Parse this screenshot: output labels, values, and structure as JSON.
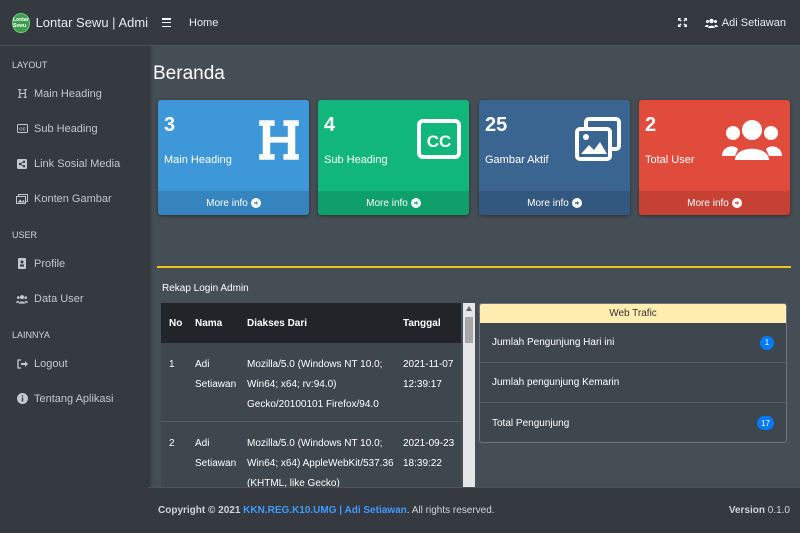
{
  "brand": {
    "logo_text": "Lontar Sewu",
    "title": "Lontar Sewu | Admin"
  },
  "topbar": {
    "home": "Home",
    "user": "Adi Setiawan"
  },
  "sidebar": {
    "sections": [
      {
        "header": "LAYOUT",
        "items": [
          {
            "label": "Main Heading",
            "icon": "heading-icon"
          },
          {
            "label": "Sub Heading",
            "icon": "closed-caption-icon"
          },
          {
            "label": "Link Sosial Media",
            "icon": "share-icon"
          },
          {
            "label": "Konten Gambar",
            "icon": "images-icon"
          }
        ]
      },
      {
        "header": "USER",
        "items": [
          {
            "label": "Profile",
            "icon": "id-badge-icon"
          },
          {
            "label": "Data User",
            "icon": "users-icon"
          }
        ]
      },
      {
        "header": "LAINNYA",
        "items": [
          {
            "label": "Logout",
            "icon": "sign-out-icon"
          },
          {
            "label": "Tentang Aplikasi",
            "icon": "info-circle-icon"
          }
        ]
      }
    ]
  },
  "page_title": "Beranda",
  "boxes": [
    {
      "value": "3",
      "label": "Main Heading",
      "more": "More info",
      "color": "#3d97d8",
      "icon": "heading-icon"
    },
    {
      "value": "4",
      "label": "Sub Heading",
      "more": "More info",
      "color": "#11b67a",
      "icon": "closed-caption-icon"
    },
    {
      "value": "25",
      "label": "Gambar Aktif",
      "more": "More info",
      "color": "#3b6591",
      "icon": "images-icon"
    },
    {
      "value": "2",
      "label": "Total User",
      "more": "More info",
      "color": "#e14b3c",
      "icon": "users-icon"
    }
  ],
  "login_card": {
    "title": "Rekap Login Admin",
    "columns": [
      "No",
      "Nama",
      "Diakses Dari",
      "Tanggal"
    ],
    "rows": [
      {
        "no": "1",
        "name": "Adi Setiawan",
        "from": "Mozilla/5.0 (Windows NT 10.0; Win64; x64; rv:94.0) Gecko/20100101 Firefox/94.0",
        "date": "2021-11-07 12:39:17"
      },
      {
        "no": "2",
        "name": "Adi Setiawan",
        "from": "Mozilla/5.0 (Windows NT 10.0; Win64; x64) AppleWebKit/537.36 (KHTML, like Gecko)",
        "date": "2021-09-23 18:39:22"
      }
    ]
  },
  "web_traffic": {
    "title": "Web Trafic",
    "items": [
      {
        "label": "Jumlah Pengunjung Hari ini",
        "badge": "1"
      },
      {
        "label": "Jumlah pengunjung Kemarin",
        "badge": ""
      },
      {
        "label": "Total Pengunjung",
        "badge": "17"
      }
    ]
  },
  "footer": {
    "copyright": "Copyright © 2021",
    "link": "KKN.REG.K10.UMG | Adi Setiawan",
    "rights": ". All rights reserved.",
    "version_label": "Version",
    "version": "0.1.0"
  }
}
